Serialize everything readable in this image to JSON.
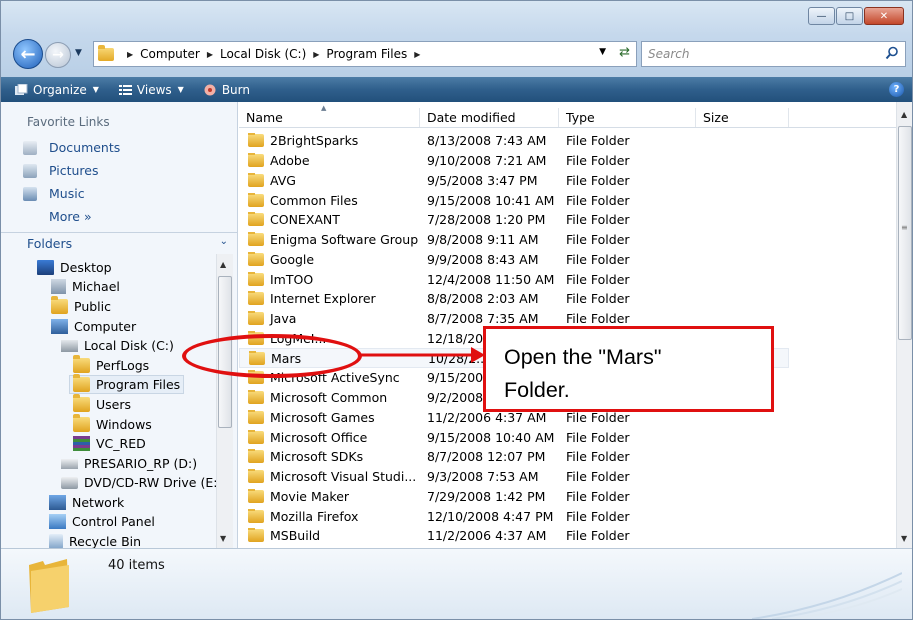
{
  "address_bar": {
    "crumbs": [
      "Computer",
      "Local Disk (C:)",
      "Program Files"
    ]
  },
  "search": {
    "placeholder": "Search"
  },
  "toolbar": {
    "organize": "Organize",
    "views": "Views",
    "burn": "Burn"
  },
  "nav_pane": {
    "favorite_links_title": "Favorite Links",
    "favorites": [
      "Documents",
      "Pictures",
      "Music"
    ],
    "more": "More »",
    "folders_title": "Folders",
    "tree": [
      "Desktop",
      "Michael",
      "Public",
      "Computer",
      "Local Disk (C:)",
      "PerfLogs",
      "Program Files",
      "Users",
      "Windows",
      "VC_RED",
      "PRESARIO_RP (D:)",
      "DVD/CD-RW Drive (E:",
      "Network",
      "Control Panel",
      "Recycle Bin"
    ],
    "selected": "Program Files"
  },
  "file_list": {
    "columns": [
      "Name",
      "Date modified",
      "Type",
      "Size"
    ],
    "rows": [
      {
        "name": "2BrightSparks",
        "date": "8/13/2008 7:43 AM",
        "type": "File Folder"
      },
      {
        "name": "Adobe",
        "date": "9/10/2008 7:21 AM",
        "type": "File Folder"
      },
      {
        "name": "AVG",
        "date": "9/5/2008 3:47 PM",
        "type": "File Folder"
      },
      {
        "name": "Common Files",
        "date": "9/15/2008 10:41 AM",
        "type": "File Folder"
      },
      {
        "name": "CONEXANT",
        "date": "7/28/2008 1:20 PM",
        "type": "File Folder"
      },
      {
        "name": "Enigma Software Group",
        "date": "9/8/2008 9:11 AM",
        "type": "File Folder"
      },
      {
        "name": "Google",
        "date": "9/9/2008 8:43 AM",
        "type": "File Folder"
      },
      {
        "name": "ImTOO",
        "date": "12/4/2008 11:50 AM",
        "type": "File Folder"
      },
      {
        "name": "Internet Explorer",
        "date": "8/8/2008 2:03 AM",
        "type": "File Folder"
      },
      {
        "name": "Java",
        "date": "8/7/2008 7:35 AM",
        "type": "File Folder"
      },
      {
        "name": "LogMeI...",
        "date": "12/18/20...",
        "type": ""
      },
      {
        "name": "Mars",
        "date": "10/28/2...",
        "type": ""
      },
      {
        "name": "Microsoft ActiveSync",
        "date": "9/15/200...",
        "type": ""
      },
      {
        "name": "Microsoft Common",
        "date": "9/2/2008...",
        "type": ""
      },
      {
        "name": "Microsoft Games",
        "date": "11/2/2006 4:37 AM",
        "type": "File Folder"
      },
      {
        "name": "Microsoft Office",
        "date": "9/15/2008 10:40 AM",
        "type": "File Folder"
      },
      {
        "name": "Microsoft SDKs",
        "date": "8/7/2008 12:07 PM",
        "type": "File Folder"
      },
      {
        "name": "Microsoft Visual Studi...",
        "date": "9/3/2008 7:53 AM",
        "type": "File Folder"
      },
      {
        "name": "Movie Maker",
        "date": "7/29/2008 1:42 PM",
        "type": "File Folder"
      },
      {
        "name": "Mozilla Firefox",
        "date": "12/10/2008 4:47 PM",
        "type": "File Folder"
      },
      {
        "name": "MSBuild",
        "date": "11/2/2006 4:37 AM",
        "type": "File Folder"
      }
    ]
  },
  "details_pane": {
    "item_count": "40 items"
  },
  "annotation": {
    "line1": "Open the \"Mars\"",
    "line2": "Folder.",
    "color": "#e01010"
  },
  "colors": {
    "toolbar": "#2f5f8c",
    "link": "#1f4e8c",
    "folder": "#e8b53a"
  }
}
